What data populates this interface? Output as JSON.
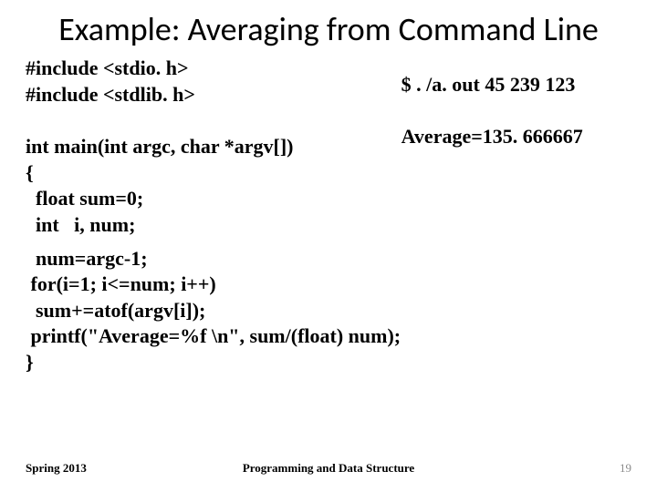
{
  "title": "Example: Averaging from Command Line",
  "code": {
    "block1": "#include <stdio. h>\n#include <stdlib. h>\n\nint main(int argc, char *argv[])\n{\n  float sum=0;\n  int   i, num;",
    "block2": "  num=argc-1;\n for(i=1; i<=num; i++)\n  sum+=atof(argv[i]);\n printf(\"Average=%f \\n\", sum/(float) num);\n}"
  },
  "output": {
    "cmd": "$ . /a. out 45 239 123",
    "result": "Average=135. 666667"
  },
  "footer": {
    "semester": "Spring 2013",
    "course": "Programming and Data Structure",
    "page": "19"
  }
}
